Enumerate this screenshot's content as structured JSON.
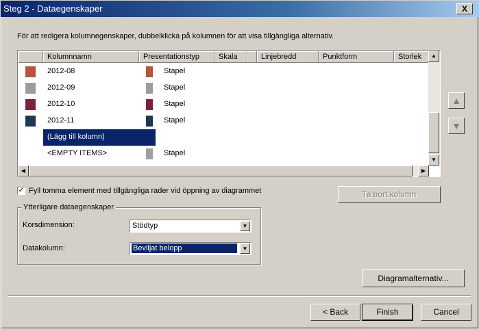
{
  "window": {
    "title": "Steg 2 - Dataegenskaper",
    "close_glyph": "X"
  },
  "instruction": "För att redigera kolumnegenskaper, dubbelklicka på kolumnen för att visa tillgängliga alternativ.",
  "grid": {
    "columns": [
      "Kolumnnamn",
      "Presentationstyp",
      "Skala",
      "Linjebredd",
      "Punktform",
      "Storlek"
    ],
    "rows": [
      {
        "name": "2012-08",
        "type": "Stapel",
        "color": "#b5533c"
      },
      {
        "name": "2012-09",
        "type": "Stapel",
        "color": "#9c9c9c"
      },
      {
        "name": "2012-10",
        "type": "Stapel",
        "color": "#7a2238"
      },
      {
        "name": "2012-11",
        "type": "Stapel",
        "color": "#1e3753"
      }
    ],
    "add_column": "(Lägg till kolumn)",
    "empty_row": {
      "name": "<EMPTY ITEMS>",
      "type": "Stapel",
      "color": "#a0a0a0"
    }
  },
  "checkbox": {
    "label": "Fyll tomma element med tillgängliga rader vid öppning av diagrammet",
    "checked": true,
    "mark": "✓"
  },
  "remove_column_button": "Ta bort kolumn",
  "group": {
    "title": "Ytterligare dataegenskaper",
    "cross_label": "Korsdimension:",
    "cross_value": "Stödtyp",
    "data_label": "Datakolumn:",
    "data_value": "Beviljat belopp"
  },
  "chart_options_button": "Diagramalternativ...",
  "buttons": {
    "back": "< Back",
    "finish": "Finish",
    "cancel": "Cancel"
  },
  "icons": {
    "up": "▲",
    "down": "▼",
    "left": "◀",
    "right": "▶"
  }
}
